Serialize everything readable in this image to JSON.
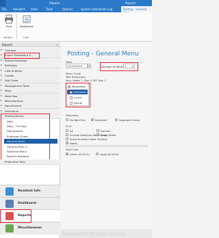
{
  "title_bar": {
    "left_text": "Reports",
    "right_text": "Reports"
  },
  "tabs": [
    {
      "label": "File"
    },
    {
      "label": "Resident"
    },
    {
      "label": "View"
    },
    {
      "label": "Tools"
    },
    {
      "label": "Options"
    },
    {
      "label": "System Interaction Log"
    },
    {
      "label": "Posting - General Menu"
    }
  ],
  "ribbon": {
    "print_label": "Print",
    "mealtimes_label": "Mealtimes",
    "group_actions": "Actions",
    "group_look": "Look"
  },
  "nav": {
    "header": "Reports",
    "header_chevron": "«",
    "groups": [
      {
        "label": "Changes",
        "expanded": true
      },
      {
        "label": "Export Dashboard E..."
      },
      {
        "label": "Special Requests"
      },
      {
        "label": "Birthdays"
      },
      {
        "label": "Cost Analysis"
      },
      {
        "label": "Credits"
      },
      {
        "label": "Diet Order"
      },
      {
        "label": "Management Team"
      },
      {
        "label": "Meal"
      },
      {
        "label": "Meal Pass"
      },
      {
        "label": "Miscellaneous"
      },
      {
        "label": "Nourishment"
      },
      {
        "label": "Nutritional"
      },
      {
        "label": "Posting Menus",
        "expanded": true
      }
    ],
    "posting_items": [
      {
        "label": "Daily"
      },
      {
        "label": "Daily - Full Day"
      },
      {
        "label": "Diet Specific"
      },
      {
        "label": "Extension Sheet"
      },
      {
        "label": "General Menu",
        "selected": true
      },
      {
        "label": "General Menu 2"
      },
      {
        "label": "Selective Menu"
      },
      {
        "label": "Specific Resident"
      }
    ],
    "last_group": "Production Tally",
    "bottom": [
      {
        "label": "Resident Info",
        "icon": "resident-info-icon",
        "color": "#3a8fd6"
      },
      {
        "label": "Dashboard",
        "icon": "dashboard-icon",
        "color": "#5a7fb8"
      },
      {
        "label": "Reports",
        "icon": "reports-icon",
        "color": "#d9534f",
        "active": true
      },
      {
        "label": "Miscellaneous",
        "icon": "miscellaneous-icon",
        "color": "#6aa84f"
      }
    ]
  },
  "main": {
    "title": "Posting - General Menu",
    "date_label": "Date",
    "date_value": "11/11/2019",
    "weeks_label": "Number of Weeks:",
    "weeks_value": "1",
    "menu_cycle_label": "Menu Cycle",
    "menu_cycle_lines": [
      "Test Production",
      "Mon, Week 1, Day 1 (M1 Day 1"
    ],
    "mealtimes": [
      {
        "label": "Mealtimes",
        "checked": true,
        "header": true
      },
      {
        "label": "Breakfast",
        "checked": true,
        "selected": true
      },
      {
        "label": "Lunch",
        "checked": false
      },
      {
        "label": "Dinner",
        "checked": false
      }
    ],
    "alternates_label": "Alternates",
    "alternates": [
      {
        "label": "Do Not Print",
        "on": false
      },
      {
        "label": "Italicized",
        "on": true
      },
      {
        "label": "Separate Group",
        "on": false
      }
    ],
    "print_label": "Print",
    "print_options": [
      {
        "label": "All",
        "checked": false
      },
      {
        "label": "Garnish",
        "checked": false
      },
      {
        "label": "Include Selective Menu Only",
        "checked": false
      },
      {
        "label": "Show Dates",
        "checked": true
      },
      {
        "label": "Show Numbers Next To Days",
        "checked": false
      },
      {
        "label": "Notes",
        "checked": true
      }
    ],
    "paper_size_label": "Paper Size",
    "paper_sizes": [
      {
        "label": "Letter (8.5x11)",
        "on": true
      },
      {
        "label": "Legal (8.5x14)",
        "on": false
      }
    ],
    "footer": "Generated Reports will Ap"
  },
  "colors": {
    "accent": "#2b79c9",
    "selection": "#1e5fa6",
    "highlight_box": "#e0242c"
  }
}
